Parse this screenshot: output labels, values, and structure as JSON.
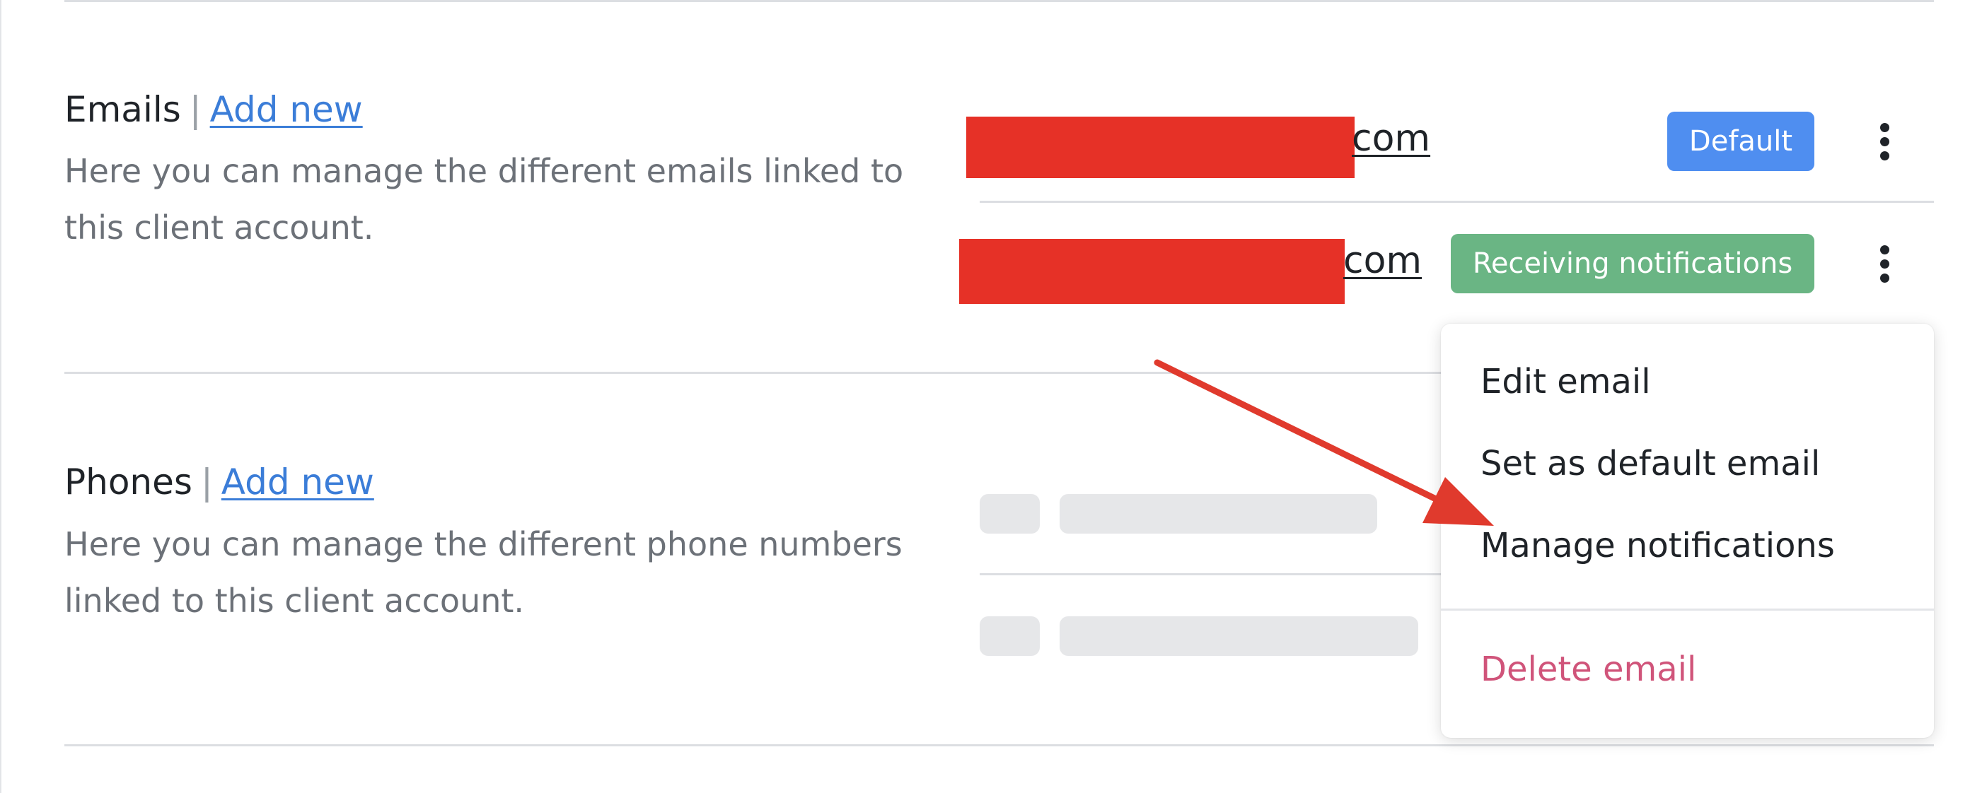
{
  "emails_section": {
    "title": "Emails",
    "separator": "|",
    "add_link": "Add new",
    "description": "Here you can manage the different emails linked to this client account.",
    "rows": [
      {
        "email_suffix": "com",
        "badge": "Default"
      },
      {
        "email_suffix": "com",
        "badge": "Receiving notifications"
      }
    ]
  },
  "phones_section": {
    "title": "Phones",
    "separator": "|",
    "add_link": "Add new",
    "description": "Here you can manage the different phone numbers linked to this client account."
  },
  "menu": {
    "items": [
      "Edit email",
      "Set as default email",
      "Manage notifications"
    ],
    "danger_item": "Delete email"
  },
  "colors": {
    "default_badge": "#4f8ef0",
    "notifications_badge": "#6ab584",
    "link": "#3b7dd8",
    "danger": "#d0547a",
    "redaction": "#e63127",
    "annotation_arrow": "#e03a2d"
  }
}
